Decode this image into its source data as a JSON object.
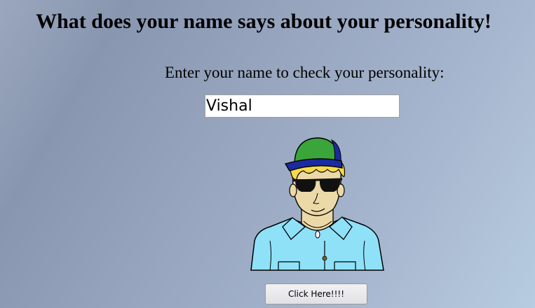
{
  "page": {
    "title": "What does your name says about your personality!"
  },
  "form": {
    "prompt": "Enter your name to check your personality:",
    "name_value": "Vishal",
    "submit_label": "Click Here!!!!"
  },
  "colors": {
    "cap_green": "#3aa53a",
    "cap_brim": "#1b2aa0",
    "hair": "#f5d94a",
    "skin": "#ecd9a8",
    "shirt": "#8fe1f8",
    "glasses": "#111111"
  },
  "icons": {
    "avatar": "avatar-guy-with-cap-and-sunglasses"
  }
}
